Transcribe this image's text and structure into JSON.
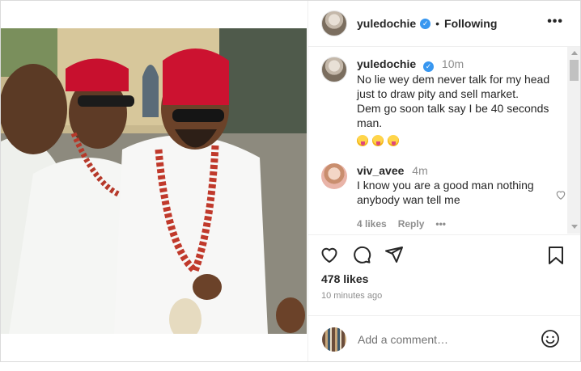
{
  "post": {
    "username": "yuledochie",
    "verified_mark": "✓",
    "separator": "•",
    "follow_status": "Following",
    "more_label": "•••"
  },
  "caption": {
    "username": "yuledochie",
    "time": "10m",
    "text_lines": [
      "No lie wey dem never talk for my head",
      "just to draw pity and sell market.",
      "Dem go soon talk say I be 40 seconds",
      "man."
    ],
    "emoji_icons": [
      "face-with-tongue-icon",
      "face-with-tongue-icon",
      "face-with-tongue-icon"
    ]
  },
  "comment": {
    "username": "viv_avee",
    "time": "4m",
    "text_lines": [
      "I know you are a good man nothing",
      "anybody wan tell me"
    ],
    "likes": "4 likes",
    "reply": "Reply",
    "more": "•••"
  },
  "actions": {
    "likes": "478 likes",
    "posted": "10 minutes ago",
    "icons": [
      "heart-icon",
      "comment-icon",
      "share-icon",
      "bookmark-icon"
    ]
  },
  "add_comment": {
    "placeholder": "Add a comment…",
    "emoji_icon": "smiley-icon"
  },
  "colors": {
    "verified": "#3897f0",
    "muted": "#8e8e8e",
    "border": "#dbdbdb"
  }
}
